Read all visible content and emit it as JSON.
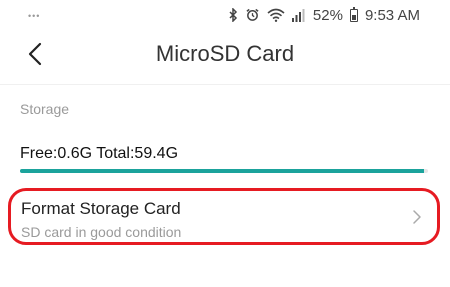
{
  "status_bar": {
    "dots": "•••",
    "battery_pct": "52%",
    "time": "9:53 AM",
    "icons": [
      "bluetooth-icon",
      "alarm-icon",
      "wifi-icon",
      "signal-icon",
      "battery-icon"
    ]
  },
  "header": {
    "title": "MicroSD Card",
    "back_icon": "chevron-left-icon"
  },
  "storage": {
    "section_label": "Storage",
    "summary": "Free:0.6G Total:59.4G",
    "used_fraction": 0.99
  },
  "format_card": {
    "title": "Format Storage Card",
    "subtitle": "SD card in good condition",
    "chevron_icon": "chevron-right-icon"
  },
  "colors": {
    "accent": "#1ba39c",
    "highlight": "#e61b22"
  }
}
